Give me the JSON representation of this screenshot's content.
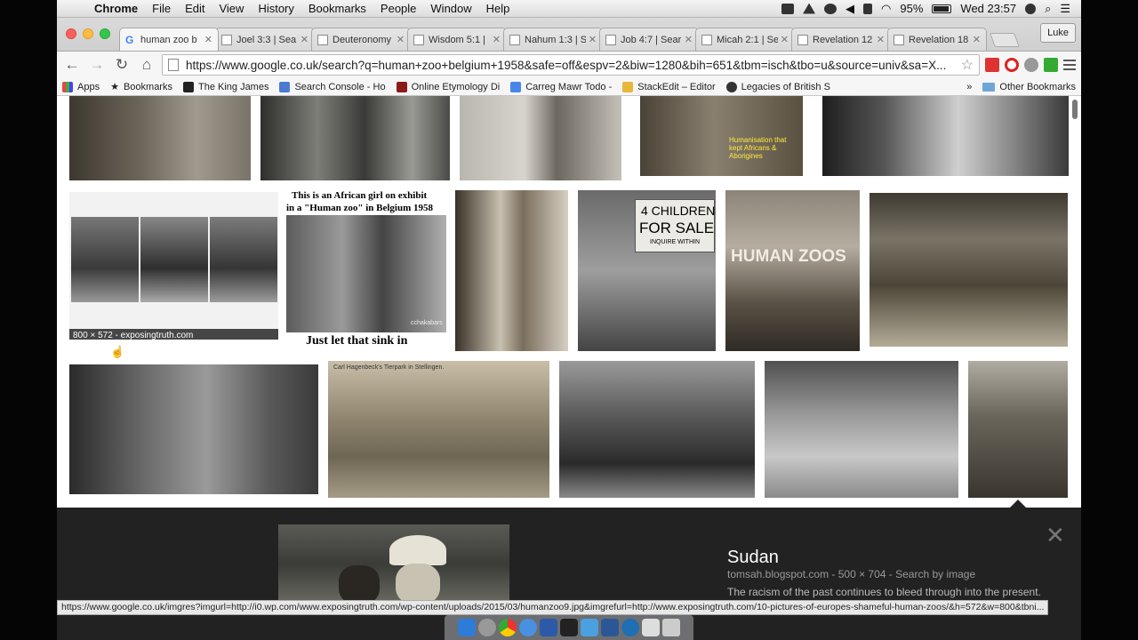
{
  "menubar": {
    "app": "Chrome",
    "items": [
      "File",
      "Edit",
      "View",
      "History",
      "Bookmarks",
      "People",
      "Window",
      "Help"
    ],
    "battery": "95%",
    "clock": "Wed 23:57"
  },
  "tabs": [
    {
      "label": "human zoo b",
      "active": true
    },
    {
      "label": "Joel 3:3 | Sea"
    },
    {
      "label": "Deuteronomy"
    },
    {
      "label": "Wisdom 5:1 |"
    },
    {
      "label": "Nahum 1:3 | S"
    },
    {
      "label": "Job 4:7 | Sear"
    },
    {
      "label": "Micah 2:1 | Se"
    },
    {
      "label": "Revelation 12"
    },
    {
      "label": "Revelation 18"
    }
  ],
  "profile": "Luke",
  "omnibox": {
    "url": "https://www.google.co.uk/search?q=human+zoo+belgium+1958&safe=off&espv=2&biw=1280&bih=651&tbm=isch&tbo=u&source=univ&sa=X..."
  },
  "bookmarks": [
    {
      "label": "Apps",
      "color": "#888"
    },
    {
      "label": "Bookmarks",
      "color": "#555"
    },
    {
      "label": "The King James",
      "color": "#222"
    },
    {
      "label": "Search Console - Ho",
      "color": "#4a7bd0"
    },
    {
      "label": "Online Etymology Di",
      "color": "#8b1a1a"
    },
    {
      "label": "Carreg Mawr Todo -",
      "color": "#4a86e8"
    },
    {
      "label": "StackEdit – Editor",
      "color": "#e8b63a"
    },
    {
      "label": "Legacies of British S",
      "color": "#333"
    }
  ],
  "bookmarks_more": "»",
  "other_bookmarks": "Other Bookmarks",
  "thumbs": {
    "girl_exhibit_line1": "This is an African girl on exhibit",
    "girl_exhibit_line2": "in a \"Human zoo\" in Belgium 1958",
    "girl_exhibit_line3": "Just let that sink in",
    "girl_exhibit_credit": "cchakabars",
    "children_sign_line1": "4 CHILDREN",
    "children_sign_line2": "FOR SALE",
    "children_sign_line3": "INQUIRE WITHIN",
    "book_title": "HUMAN ZOOS",
    "postcard_caption": "Carl Hagenbeck's Tierpark in Stellingen.",
    "yellow_text": "Humanisation that kept Africans & Aborigines",
    "hover_info": "800 × 572 - exposingtruth.com"
  },
  "detail": {
    "title": "Sudan",
    "meta": "tomsah.blogspot.com - 500 × 704 - Search by image",
    "description": "The racism of the past continues to bleed through into the present.",
    "close": "✕"
  },
  "status_url": "https://www.google.co.uk/imgres?imgurl=http://i0.wp.com/www.exposingtruth.com/wp-content/uploads/2015/03/humanzoo9.jpg&imgrefurl=http://www.exposingtruth.com/10-pictures-of-europes-shameful-human-zoos/&h=572&w=800&tbni..."
}
